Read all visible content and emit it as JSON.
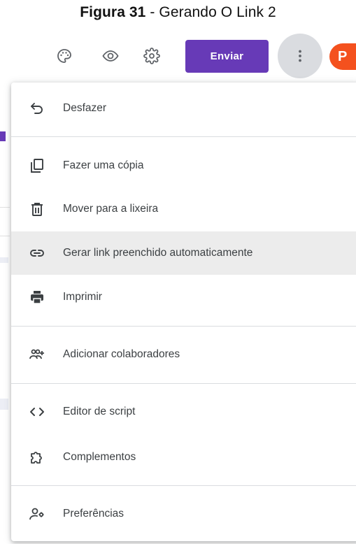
{
  "caption": {
    "bold": "Figura 31",
    "rest": " - Gerando O Link 2"
  },
  "toolbar": {
    "send_label": "Enviar",
    "avatar_letter": "P",
    "icons": [
      "palette-icon",
      "eye-icon",
      "gear-icon",
      "more-vert-icon"
    ]
  },
  "menu": {
    "items": [
      {
        "label": "Desfazer",
        "icon": "undo-icon"
      },
      {
        "label": "Fazer uma cópia",
        "icon": "copy-icon"
      },
      {
        "label": "Mover para a lixeira",
        "icon": "trash-icon"
      },
      {
        "label": "Gerar link preenchido automaticamente",
        "icon": "link-icon",
        "highlighted": true
      },
      {
        "label": "Imprimir",
        "icon": "print-icon"
      },
      {
        "label": "Adicionar colaboradores",
        "icon": "add-people-icon"
      },
      {
        "label": "Editor de script",
        "icon": "code-icon"
      },
      {
        "label": "Complementos",
        "icon": "puzzle-icon"
      },
      {
        "label": "Preferências",
        "icon": "person-settings-icon"
      }
    ]
  },
  "colors": {
    "accent": "#673ab7",
    "avatar": "#f4511e",
    "highlight": "#ececec"
  }
}
